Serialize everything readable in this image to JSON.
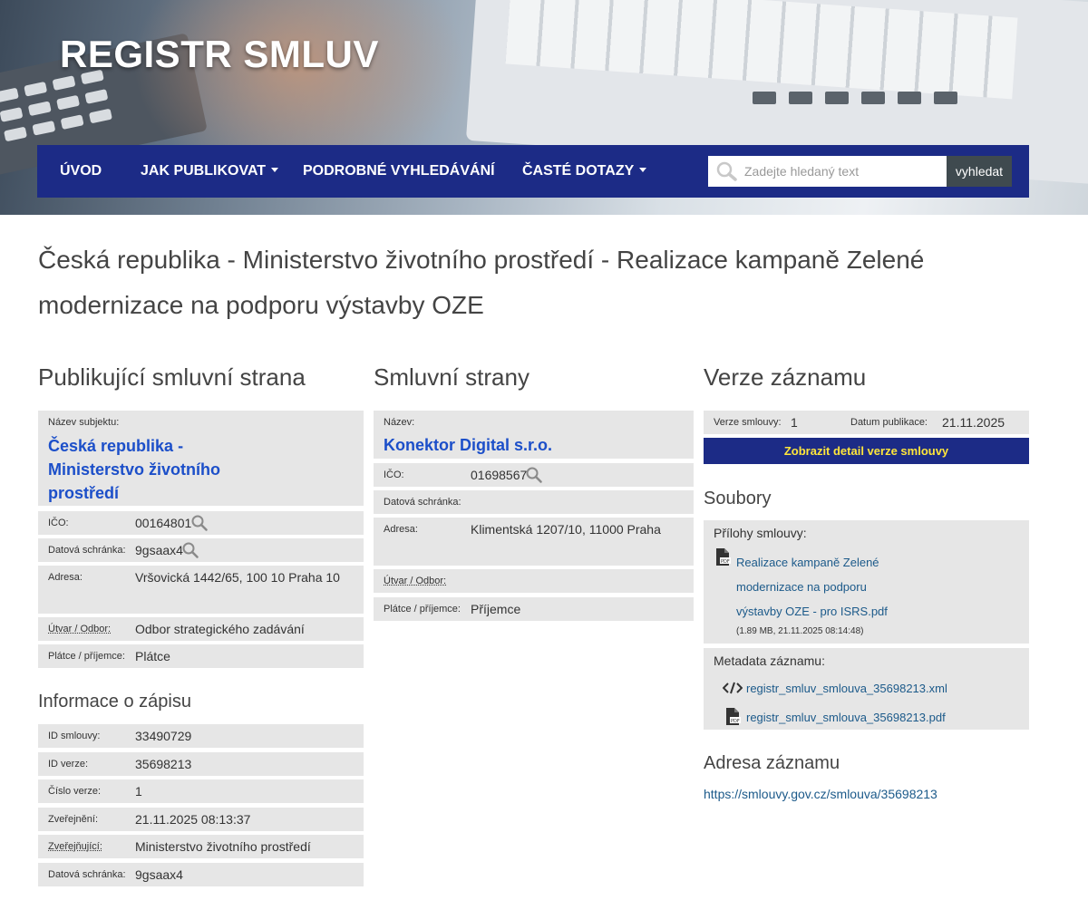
{
  "site": {
    "title": "REGISTR SMLUV"
  },
  "nav": {
    "items": [
      {
        "label": "ÚVOD"
      },
      {
        "label": "JAK PUBLIKOVAT"
      },
      {
        "label": "PODROBNÉ VYHLEDÁVÁNÍ"
      },
      {
        "label": "ČASTÉ DOTAZY"
      }
    ],
    "search_placeholder": "Zadejte hledaný text",
    "search_button": "vyhledat"
  },
  "page_title": "Česká republika - Ministerstvo životního prostředí - Realizace kampaně Zelené modernizace na podporu výstavby OZE",
  "publisher": {
    "heading": "Publikující smluvní strana",
    "name_label": "Název subjektu:",
    "name": "Česká republika - Ministerstvo životního prostředí",
    "ico_label": "IČO:",
    "ico": "00164801",
    "databox_label": "Datová schránka:",
    "databox": "9gsaax4",
    "address_label": "Adresa:",
    "address": "Vršovická 1442/65, 100 10 Praha 10",
    "dept_label": "Útvar / Odbor:",
    "dept": "Odbor strategického zadávání",
    "payer_label": "Plátce / příjemce:",
    "payer": "Plátce"
  },
  "record_info": {
    "heading": "Informace o zápisu",
    "rows": [
      {
        "label": "ID smlouvy:",
        "value": "33490729"
      },
      {
        "label": "ID verze:",
        "value": "35698213"
      },
      {
        "label": "Číslo verze:",
        "value": "1"
      },
      {
        "label": "Zveřejnění:",
        "value": "21.11.2025 08:13:37"
      },
      {
        "label": "Zveřejňující:",
        "value": "Ministerstvo životního prostředí"
      },
      {
        "label": "Datová schránka:",
        "value": "9gsaax4"
      }
    ]
  },
  "parties": {
    "heading": "Smluvní strany",
    "name_label": "Název:",
    "name": "Konektor Digital s.r.o.",
    "ico_label": "IČO:",
    "ico": "01698567",
    "databox_label": "Datová schránka:",
    "address_label": "Adresa:",
    "address": "Klimentská 1207/10, 11000 Praha",
    "dept_label": "Útvar / Odbor:",
    "payer_label": "Plátce / příjemce:",
    "payer": "Příjemce"
  },
  "version": {
    "heading": "Verze záznamu",
    "version_label": "Verze smlouvy:",
    "version_value": "1",
    "date_label": "Datum publikace:",
    "date_value": "21.11.2025",
    "detail_button": "Zobrazit detail verze smlouvy"
  },
  "files": {
    "heading": "Soubory",
    "attachments_label": "Přílohy smlouvy:",
    "attachment": {
      "name_lines": [
        "Realizace kampaně Zelené",
        "modernizace na podporu",
        "výstavby OZE - pro ISRS.pdf"
      ],
      "meta": "(1.89 MB, 21.11.2025 08:14:48)"
    },
    "metadata_label": "Metadata záznamu:",
    "xml_link": "registr_smluv_smlouva_35698213.xml",
    "pdf_link": "registr_smluv_smlouva_35698213.pdf"
  },
  "address_block": {
    "heading": "Adresa záznamu",
    "url": "https://smlouvy.gov.cz/smlouva/35698213"
  },
  "colors": {
    "nav_bg": "#1c2b86",
    "button_text": "#ffe63b",
    "row_bg": "#e6e6e6",
    "link": "#1c4fc9"
  }
}
